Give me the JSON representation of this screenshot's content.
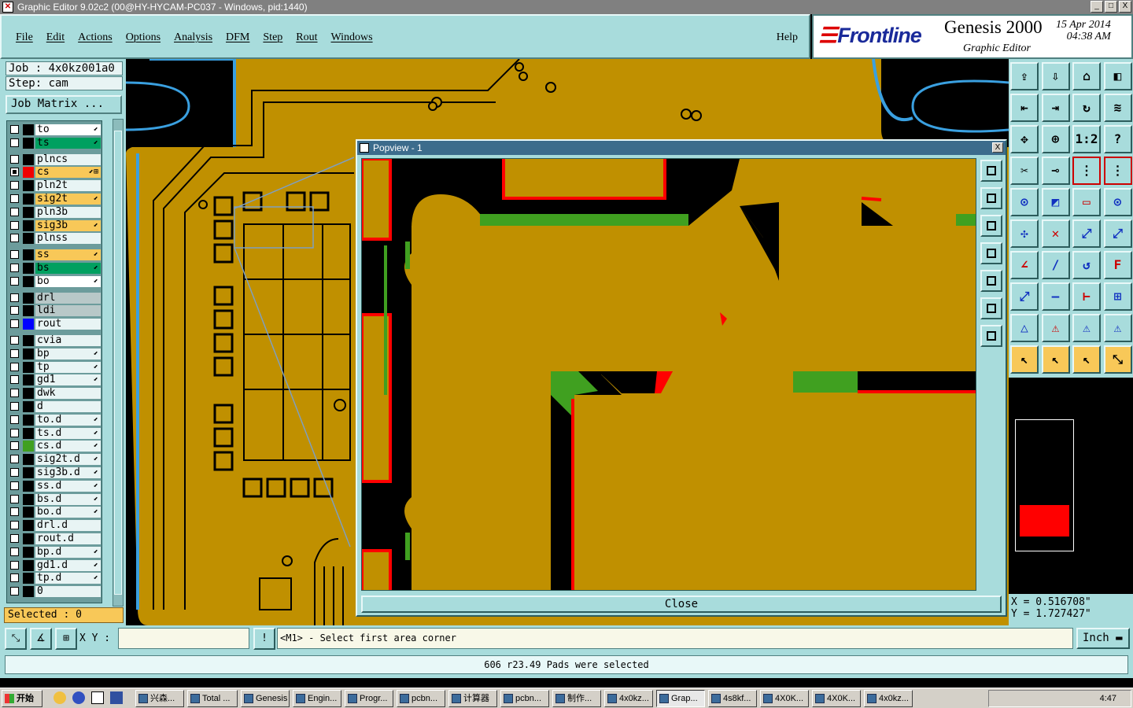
{
  "window": {
    "title": "Graphic Editor 9.02c2 (00@HY-HYCAM-PC037 - Windows, pid:1440)",
    "min": "_",
    "max": "□",
    "close": "X"
  },
  "menu": {
    "items": [
      "File",
      "Edit",
      "Actions",
      "Options",
      "Analysis",
      "DFM",
      "Step",
      "Rout",
      "Windows"
    ],
    "help": "Help"
  },
  "brand": {
    "logo": "Frontline",
    "product": "Genesis 2000",
    "subtitle": "Graphic Editor",
    "date": "15 Apr 2014",
    "time": "04:38 AM"
  },
  "job": {
    "job_line": "Job : 4x0kz001a0",
    "step_line": "Step: cam",
    "matrix_button": "Job Matrix ..."
  },
  "layers": [
    {
      "name": "to",
      "color": "#ffffff",
      "swatch": "#000000",
      "tick": "⬋"
    },
    {
      "name": "ts",
      "color": "#00a060",
      "swatch": "#000000",
      "tick": "⬋"
    },
    {
      "name": "plncs",
      "color": "#e8f4f4",
      "swatch": "#000000",
      "tick": ""
    },
    {
      "name": "cs",
      "color": "#f8c858",
      "swatch": "#f00000",
      "tick": "⬋⊞",
      "active": true
    },
    {
      "name": "pln2t",
      "color": "#e8f4f4",
      "swatch": "#000000",
      "tick": ""
    },
    {
      "name": "sig2t",
      "color": "#f8c858",
      "swatch": "#000000",
      "tick": "⬋"
    },
    {
      "name": "pln3b",
      "color": "#e8f4f4",
      "swatch": "#000000",
      "tick": ""
    },
    {
      "name": "sig3b",
      "color": "#f8c858",
      "swatch": "#000000",
      "tick": "⬋"
    },
    {
      "name": "plnss",
      "color": "#e8f4f4",
      "swatch": "#000000",
      "tick": ""
    },
    {
      "name": "ss",
      "color": "#f8c858",
      "swatch": "#000000",
      "tick": "⬋"
    },
    {
      "name": "bs",
      "color": "#00a060",
      "swatch": "#000000",
      "tick": "⬋"
    },
    {
      "name": "bo",
      "color": "#ffffff",
      "swatch": "#000000",
      "tick": "⬋"
    },
    {
      "name": "drl",
      "color": "#b8c8c8",
      "swatch": "#000000",
      "tick": ""
    },
    {
      "name": "ldi",
      "color": "#b8c8c8",
      "swatch": "#000000",
      "tick": ""
    },
    {
      "name": "rout",
      "color": "#e8f4f4",
      "swatch": "#0000ff",
      "tick": ""
    },
    {
      "name": "cvia",
      "color": "#e8f4f4",
      "swatch": "#000000",
      "tick": ""
    },
    {
      "name": "bp",
      "color": "#e8f4f4",
      "swatch": "#000000",
      "tick": "⬋"
    },
    {
      "name": "tp",
      "color": "#e8f4f4",
      "swatch": "#000000",
      "tick": "⬋"
    },
    {
      "name": "gd1",
      "color": "#e8f4f4",
      "swatch": "#000000",
      "tick": "⬋"
    },
    {
      "name": "dwk",
      "color": "#e8f4f4",
      "swatch": "#000000",
      "tick": ""
    },
    {
      "name": "d",
      "color": "#e8f4f4",
      "swatch": "#000000",
      "tick": ""
    },
    {
      "name": "to.d",
      "color": "#e8f4f4",
      "swatch": "#000000",
      "tick": "⬋"
    },
    {
      "name": "ts.d",
      "color": "#e8f4f4",
      "swatch": "#000000",
      "tick": "⬋"
    },
    {
      "name": "cs.d",
      "color": "#e8f4f4",
      "swatch": "#40a020",
      "tick": "⬋"
    },
    {
      "name": "sig2t.d",
      "color": "#e8f4f4",
      "swatch": "#000000",
      "tick": "⬋"
    },
    {
      "name": "sig3b.d",
      "color": "#e8f4f4",
      "swatch": "#000000",
      "tick": "⬋"
    },
    {
      "name": "ss.d",
      "color": "#e8f4f4",
      "swatch": "#000000",
      "tick": "⬋"
    },
    {
      "name": "bs.d",
      "color": "#e8f4f4",
      "swatch": "#000000",
      "tick": "⬋"
    },
    {
      "name": "bo.d",
      "color": "#e8f4f4",
      "swatch": "#000000",
      "tick": "⬋"
    },
    {
      "name": "drl.d",
      "color": "#e8f4f4",
      "swatch": "#000000",
      "tick": ""
    },
    {
      "name": "rout.d",
      "color": "#e8f4f4",
      "swatch": "#000000",
      "tick": ""
    },
    {
      "name": "bp.d",
      "color": "#e8f4f4",
      "swatch": "#000000",
      "tick": "⬋"
    },
    {
      "name": "gd1.d",
      "color": "#e8f4f4",
      "swatch": "#000000",
      "tick": "⬋"
    },
    {
      "name": "tp.d",
      "color": "#e8f4f4",
      "swatch": "#000000",
      "tick": "⬋"
    },
    {
      "name": "0",
      "color": "#e8f4f4",
      "swatch": "#000000",
      "tick": ""
    }
  ],
  "selected_label": "Selected : 0",
  "popview": {
    "title": "Popview - 1",
    "close_label": "Close",
    "close_x": "X"
  },
  "tools": [
    "⇪",
    "⇩",
    "⌂",
    "◧",
    "⇤",
    "⇥",
    "↻",
    "≋",
    "✥",
    "⊕",
    "1:2",
    "?",
    "✂",
    "⊸",
    "⋮",
    "⋮",
    "⊙",
    "◩",
    "▭",
    "⊙",
    "✣",
    "✕",
    "⤢",
    "⤢",
    "∠",
    "∕",
    "↺",
    "F",
    "⤢",
    "—",
    "⊢",
    "⊞",
    "△",
    "⚠",
    "⚠",
    "⚠",
    "↖",
    "↖",
    "↖",
    "⤡"
  ],
  "coords": {
    "x": "X  = 0.516708\"",
    "y": "Y  = 1.727427\""
  },
  "cmd": {
    "xy_label": "X Y :",
    "prompt": "<M1> - Select first area corner",
    "units": "Inch",
    "exclaim": "!"
  },
  "status": "606 r23.49 Pads were selected",
  "taskbar": {
    "start": "开始",
    "tasks": [
      "兴森...",
      "Total ...",
      "Genesis",
      "Engin...",
      "Progr...",
      "pcbn...",
      "计算器",
      "pcbn...",
      "制作...",
      "4x0kz...",
      "Grap...",
      "4s8kf...",
      "4X0K...",
      "4X0K...",
      "4x0kz..."
    ],
    "active_index": 10,
    "time": "4:47"
  },
  "colors": {
    "panel": "#a8dcdc",
    "copper": "#c09000",
    "highlight_red": "#ff0000",
    "highlight_green": "#40a020"
  }
}
